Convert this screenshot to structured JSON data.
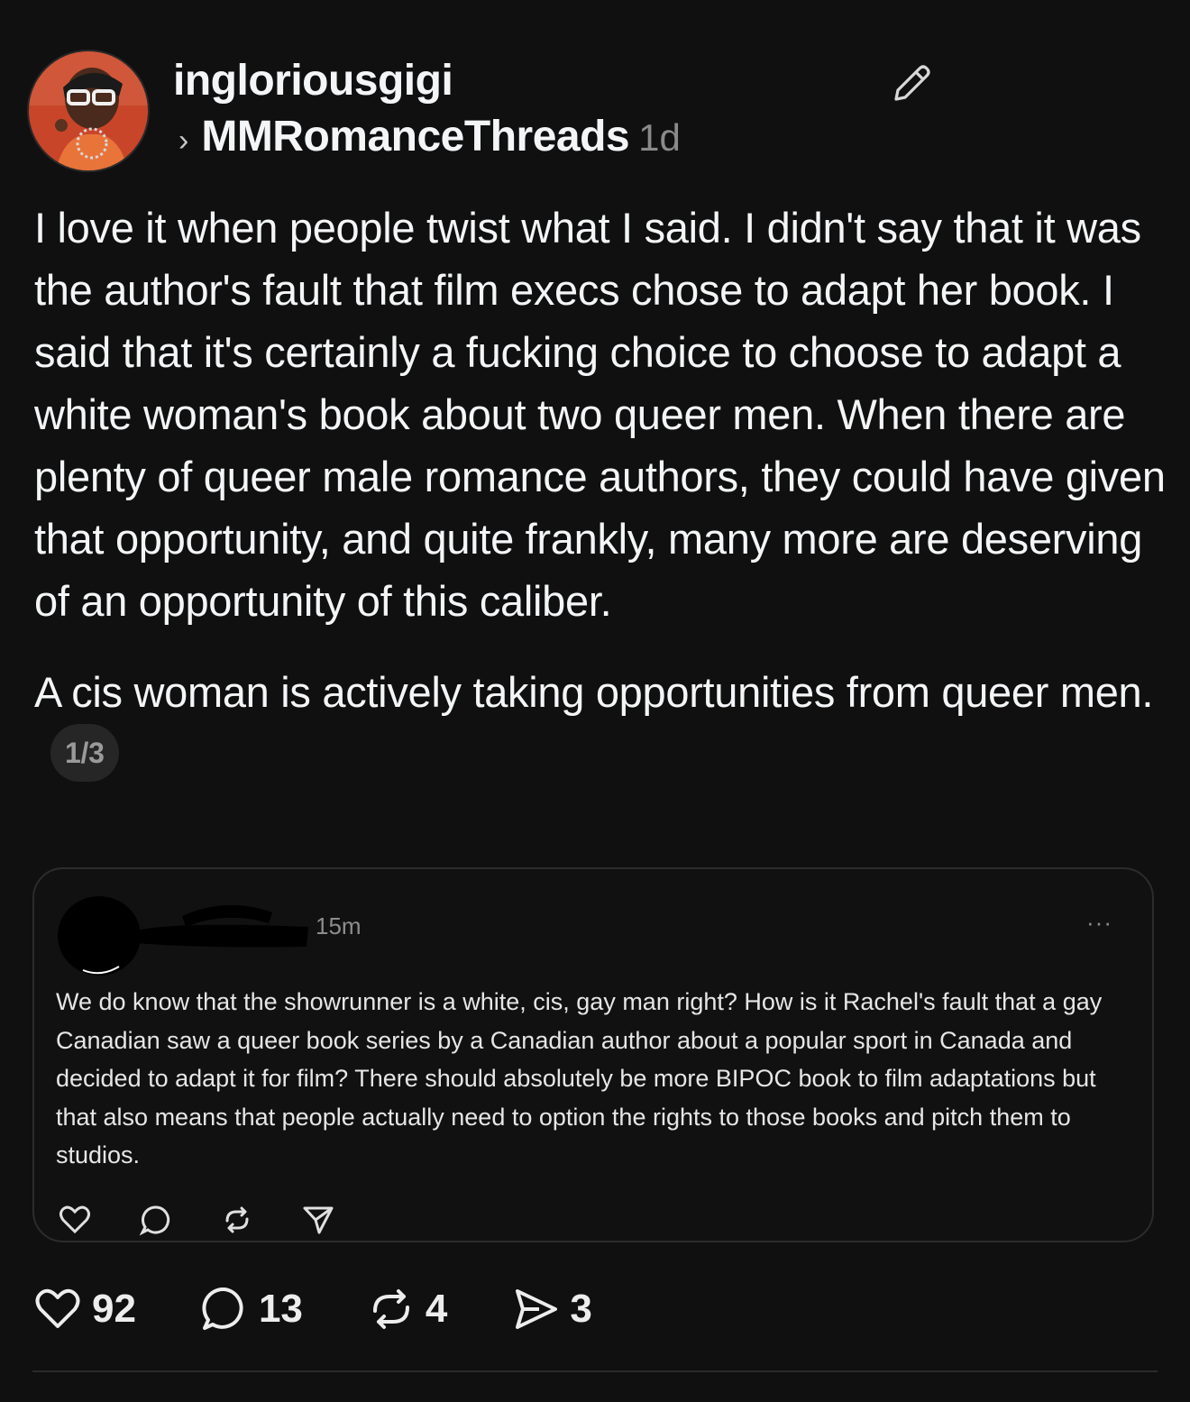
{
  "post": {
    "username": "ingloriousgigi",
    "community": "MMRomanceThreads",
    "age": "1d",
    "paragraphs": [
      "I love it when people twist what I said.  I didn't say that it was the author's fault that film execs chose to adapt her book.  I said that it's certainly a fucking choice to choose to adapt a white woman's book about two queer men. When there are plenty of queer male romance authors, they could have given that opportunity, and quite frankly, many more are deserving of an opportunity of this caliber.",
      "A cis woman is actively taking opportunities from queer men."
    ],
    "thread_position": "1/3"
  },
  "quoted": {
    "age": "15m",
    "more": "···",
    "text": "We do know that the showrunner is a white, cis, gay man right? How is it Rachel's fault that a gay Canadian saw a queer book series by a Canadian author about a popular sport in Canada and decided to adapt it for film? There should absolutely be more BIPOC book to film adaptations but that also means that people actually need to option the rights to those books and pitch them to studios.",
    "actions": [
      "heart-icon",
      "comment-icon",
      "repost-icon",
      "share-icon"
    ]
  },
  "stats": {
    "likes": "92",
    "replies": "13",
    "reposts": "4",
    "shares": "3"
  },
  "colors": {
    "background": "#101010",
    "text": "#f3f5f7",
    "muted": "#8a8a8a",
    "badge_bg": "#262626"
  }
}
